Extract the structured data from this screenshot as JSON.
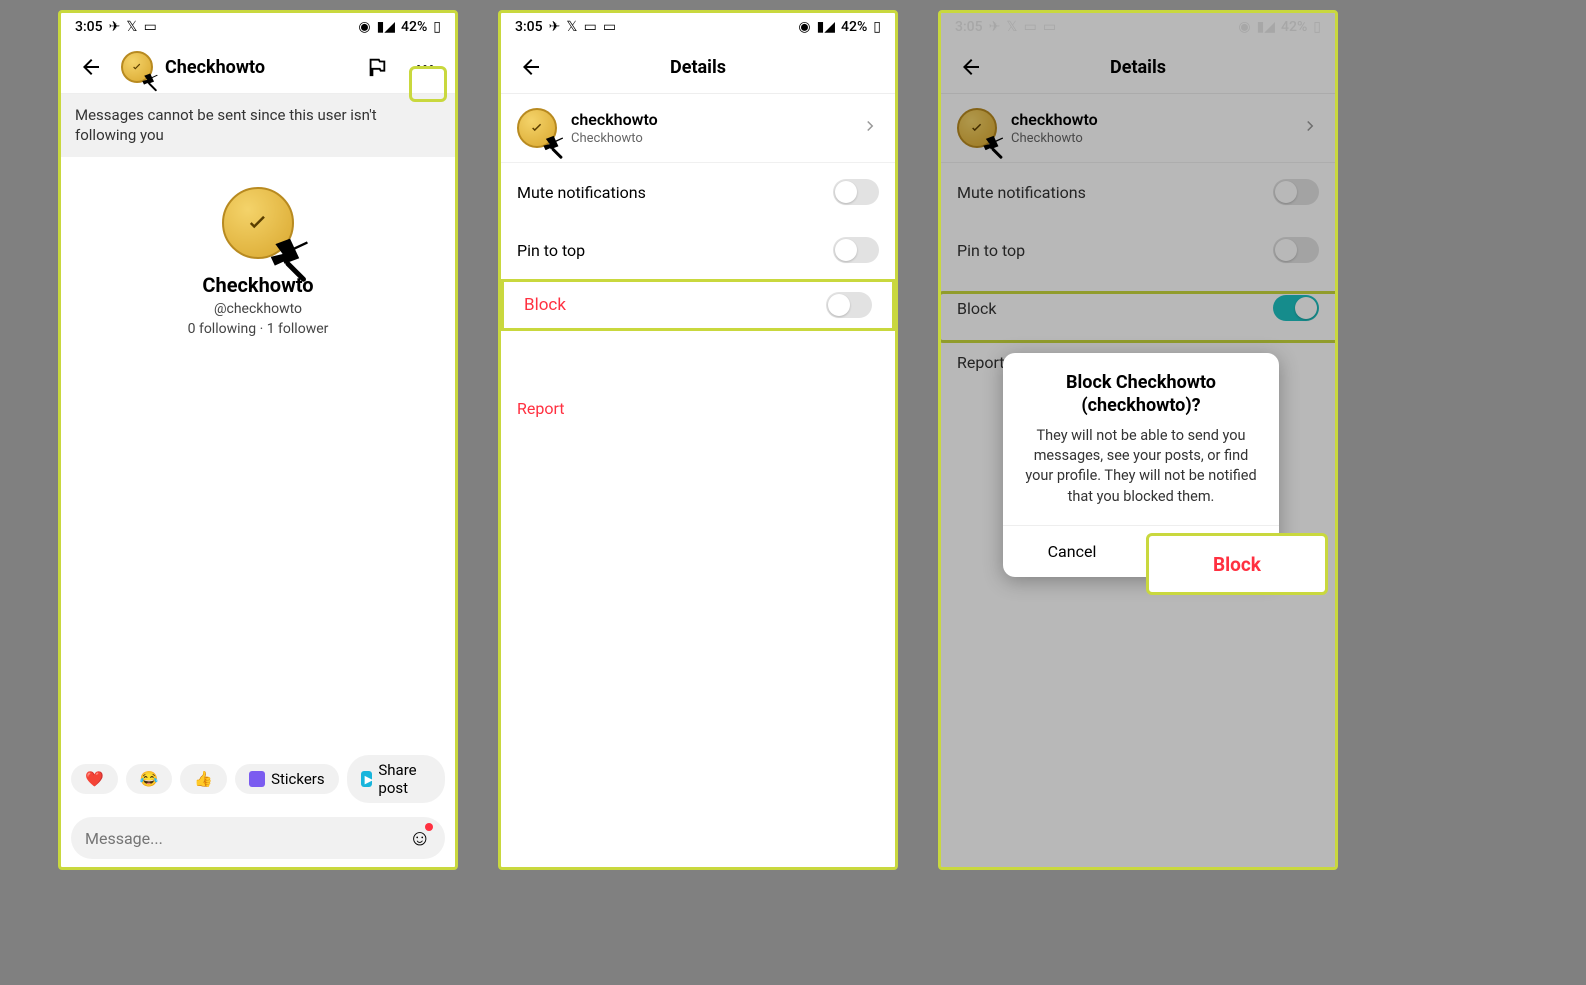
{
  "status": {
    "time": "3:05",
    "battery": "42%"
  },
  "screen1": {
    "title": "Checkhowto",
    "notice": "Messages cannot be sent since this user isn't following you",
    "profile_name": "Checkhowto",
    "handle": "@checkhowto",
    "stats": "0 following · 1 follower",
    "reactions": {
      "stickers": "Stickers",
      "share": "Share post"
    },
    "message_placeholder": "Message..."
  },
  "screen2": {
    "title": "Details",
    "user_name": "checkhowto",
    "user_sub": "Checkhowto",
    "mute": "Mute notifications",
    "pin": "Pin to top",
    "block": "Block",
    "report": "Report"
  },
  "screen3": {
    "title": "Details",
    "user_name": "checkhowto",
    "user_sub": "Checkhowto",
    "mute": "Mute notifications",
    "pin": "Pin to top",
    "block": "Block",
    "report": "Report",
    "dialog_title": "Block Checkhowto (checkhowto)?",
    "dialog_body": "They will not be able to send you messages, see your posts, or find your profile. They will not be notified that you blocked them.",
    "cancel": "Cancel",
    "block_btn": "Block"
  }
}
